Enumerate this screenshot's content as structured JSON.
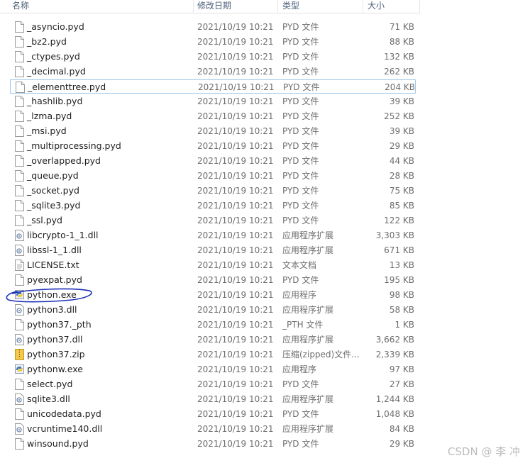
{
  "headers": {
    "name": "名称",
    "date": "修改日期",
    "type": "类型",
    "size": "大小"
  },
  "files": [
    {
      "name": "_asyncio.pyd",
      "date": "2021/10/19 10:21",
      "type": "PYD 文件",
      "size": "71 KB",
      "icon": "file-icon"
    },
    {
      "name": "_bz2.pyd",
      "date": "2021/10/19 10:21",
      "type": "PYD 文件",
      "size": "88 KB",
      "icon": "file-icon"
    },
    {
      "name": "_ctypes.pyd",
      "date": "2021/10/19 10:21",
      "type": "PYD 文件",
      "size": "132 KB",
      "icon": "file-icon"
    },
    {
      "name": "_decimal.pyd",
      "date": "2021/10/19 10:21",
      "type": "PYD 文件",
      "size": "262 KB",
      "icon": "file-icon"
    },
    {
      "name": "_elementtree.pyd",
      "date": "2021/10/19 10:21",
      "type": "PYD 文件",
      "size": "204 KB",
      "icon": "file-icon",
      "selected": true
    },
    {
      "name": "_hashlib.pyd",
      "date": "2021/10/19 10:21",
      "type": "PYD 文件",
      "size": "39 KB",
      "icon": "file-icon"
    },
    {
      "name": "_lzma.pyd",
      "date": "2021/10/19 10:21",
      "type": "PYD 文件",
      "size": "252 KB",
      "icon": "file-icon"
    },
    {
      "name": "_msi.pyd",
      "date": "2021/10/19 10:21",
      "type": "PYD 文件",
      "size": "39 KB",
      "icon": "file-icon"
    },
    {
      "name": "_multiprocessing.pyd",
      "date": "2021/10/19 10:21",
      "type": "PYD 文件",
      "size": "29 KB",
      "icon": "file-icon"
    },
    {
      "name": "_overlapped.pyd",
      "date": "2021/10/19 10:21",
      "type": "PYD 文件",
      "size": "44 KB",
      "icon": "file-icon"
    },
    {
      "name": "_queue.pyd",
      "date": "2021/10/19 10:21",
      "type": "PYD 文件",
      "size": "28 KB",
      "icon": "file-icon"
    },
    {
      "name": "_socket.pyd",
      "date": "2021/10/19 10:21",
      "type": "PYD 文件",
      "size": "75 KB",
      "icon": "file-icon"
    },
    {
      "name": "_sqlite3.pyd",
      "date": "2021/10/19 10:21",
      "type": "PYD 文件",
      "size": "85 KB",
      "icon": "file-icon"
    },
    {
      "name": "_ssl.pyd",
      "date": "2021/10/19 10:21",
      "type": "PYD 文件",
      "size": "122 KB",
      "icon": "file-icon"
    },
    {
      "name": "libcrypto-1_1.dll",
      "date": "2021/10/19 10:21",
      "type": "应用程序扩展",
      "size": "3,303 KB",
      "icon": "dll-icon"
    },
    {
      "name": "libssl-1_1.dll",
      "date": "2021/10/19 10:21",
      "type": "应用程序扩展",
      "size": "671 KB",
      "icon": "dll-icon"
    },
    {
      "name": "LICENSE.txt",
      "date": "2021/10/19 10:21",
      "type": "文本文档",
      "size": "13 KB",
      "icon": "text-file-icon"
    },
    {
      "name": "pyexpat.pyd",
      "date": "2021/10/19 10:21",
      "type": "PYD 文件",
      "size": "195 KB",
      "icon": "file-icon"
    },
    {
      "name": "python.exe",
      "date": "2021/10/19 10:21",
      "type": "应用程序",
      "size": "98 KB",
      "icon": "python-exe-icon"
    },
    {
      "name": "python3.dll",
      "date": "2021/10/19 10:21",
      "type": "应用程序扩展",
      "size": "58 KB",
      "icon": "dll-icon"
    },
    {
      "name": "python37._pth",
      "date": "2021/10/19 10:21",
      "type": "_PTH 文件",
      "size": "1 KB",
      "icon": "file-icon"
    },
    {
      "name": "python37.dll",
      "date": "2021/10/19 10:21",
      "type": "应用程序扩展",
      "size": "3,662 KB",
      "icon": "dll-icon"
    },
    {
      "name": "python37.zip",
      "date": "2021/10/19 10:21",
      "type": "压缩(zipped)文件...",
      "size": "2,339 KB",
      "icon": "zip-icon"
    },
    {
      "name": "pythonw.exe",
      "date": "2021/10/19 10:21",
      "type": "应用程序",
      "size": "97 KB",
      "icon": "pythonw-exe-icon"
    },
    {
      "name": "select.pyd",
      "date": "2021/10/19 10:21",
      "type": "PYD 文件",
      "size": "27 KB",
      "icon": "file-icon"
    },
    {
      "name": "sqlite3.dll",
      "date": "2021/10/19 10:21",
      "type": "应用程序扩展",
      "size": "1,244 KB",
      "icon": "dll-icon"
    },
    {
      "name": "unicodedata.pyd",
      "date": "2021/10/19 10:21",
      "type": "PYD 文件",
      "size": "1,048 KB",
      "icon": "file-icon"
    },
    {
      "name": "vcruntime140.dll",
      "date": "2021/10/19 10:21",
      "type": "应用程序扩展",
      "size": "84 KB",
      "icon": "dll-icon"
    },
    {
      "name": "winsound.pyd",
      "date": "2021/10/19 10:21",
      "type": "PYD 文件",
      "size": "29 KB",
      "icon": "file-icon"
    }
  ],
  "watermark": "CSDN @ 李 冲",
  "colors": {
    "header_text": "#4c607a",
    "selection_border": "#99c9ef",
    "annotation": "#1a2fb5"
  }
}
